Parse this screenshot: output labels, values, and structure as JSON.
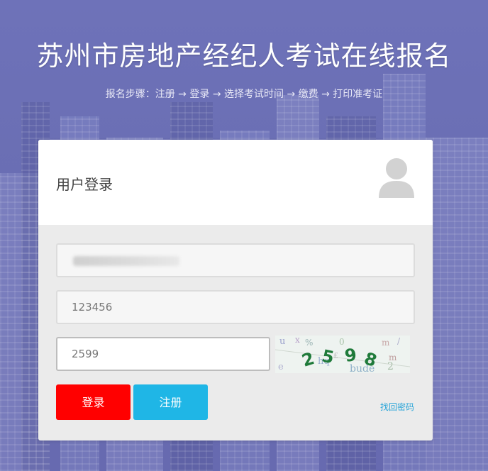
{
  "page": {
    "title": "苏州市房地产经纪人考试在线报名",
    "steps": "报名步骤：注册 → 登录 → 选择考试时间 → 缴费 → 打印准考证"
  },
  "login": {
    "heading": "用户登录",
    "username_value": "",
    "password_value": "123456",
    "captcha_value": "2599",
    "captcha_image_text": "2598",
    "login_button": "登录",
    "register_button": "注册",
    "forgot_link": "找回密码"
  },
  "colors": {
    "background": "#6b6fb4",
    "login_button": "#ff0000",
    "register_button": "#1fb6e6",
    "link": "#2aa5d8",
    "captcha_digits": "#1f7a3a"
  },
  "icons": {
    "avatar": "user-avatar-icon"
  }
}
